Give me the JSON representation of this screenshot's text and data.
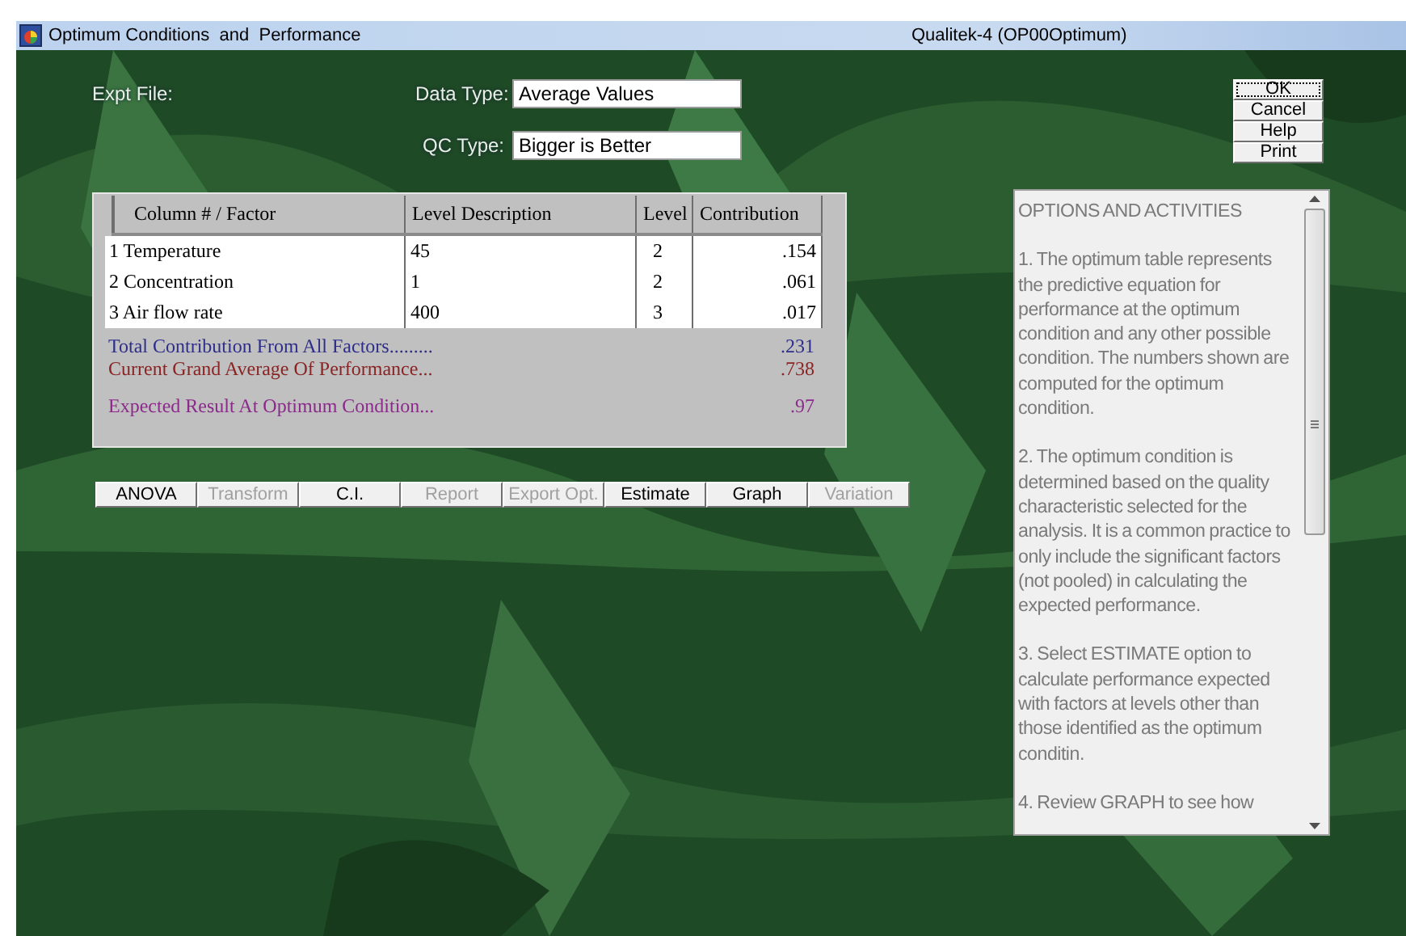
{
  "window": {
    "title": "Optimum Conditions  and  Performance",
    "app_title": "Qualitek-4 (OP00Optimum)"
  },
  "header": {
    "expt_file": {
      "label": "Expt File:"
    },
    "data_type": {
      "label": "Data Type:",
      "value": "Average Values"
    },
    "qc_type": {
      "label": "QC Type:",
      "value": "Bigger is Better"
    }
  },
  "dialog_buttons": [
    {
      "label": "OK",
      "focused": true
    },
    {
      "label": "Cancel",
      "focused": false
    },
    {
      "label": "Help",
      "focused": false
    },
    {
      "label": "Print",
      "focused": false
    }
  ],
  "table": {
    "columns": [
      "Column # / Factor",
      "Level Description",
      "Level",
      "Contribution"
    ],
    "rows": [
      {
        "factor": "1 Temperature",
        "level_description": "45",
        "level": "2",
        "contribution": ".154"
      },
      {
        "factor": "2 Concentration",
        "level_description": "1",
        "level": "2",
        "contribution": ".061"
      },
      {
        "factor": "3 Air flow rate",
        "level_description": "400",
        "level": "3",
        "contribution": ".017"
      }
    ]
  },
  "summary": [
    {
      "kind": "line",
      "label": "Total Contribution From All Factors.........",
      "value": ".231",
      "color": "#2e2e8a"
    },
    {
      "kind": "line",
      "label": "Current Grand Average Of Performance...",
      "value": ".738",
      "color": "#8a2424"
    },
    {
      "kind": "result",
      "label": "Expected Result At Optimum Condition...",
      "value": ".97",
      "color": "#8c2a8c"
    }
  ],
  "actions": [
    {
      "label": "ANOVA",
      "disabled": false
    },
    {
      "label": "Transform",
      "disabled": true
    },
    {
      "label": "C.I.",
      "disabled": false
    },
    {
      "label": "Report",
      "disabled": true
    },
    {
      "label": "Export Opt.",
      "disabled": true
    },
    {
      "label": "Estimate",
      "disabled": false
    },
    {
      "label": "Graph",
      "disabled": false
    },
    {
      "label": "Variation",
      "disabled": true
    }
  ],
  "options_panel": {
    "title": "OPTIONS AND ACTIVITIES",
    "paragraphs": [
      "1. The optimum table represents the predictive equation for performance at the optimum condition and any other possible condition. The numbers shown are computed for the optimum condition.",
      "2. The optimum condition is determined based on the quality characteristic selected for the analysis. It is a common practice to only include the significant factors (not pooled) in calculating the expected performance.",
      "3. Select ESTIMATE option to calculate performance expected with factors at levels other than those identified as the optimum conditin.",
      "4. Review GRAPH to see how"
    ]
  }
}
